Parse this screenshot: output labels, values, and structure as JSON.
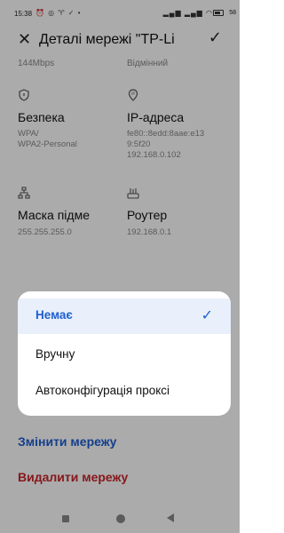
{
  "status_bar": {
    "time": "15:38",
    "left_icons": "⏰ ◎ ♈ ✓ •",
    "right_icons": "▂▄▆ ▂▄▆ ◠",
    "battery": "58"
  },
  "header": {
    "title": "Деталі мережі \"TP-Li",
    "close_icon": "close-icon",
    "confirm_icon": "check-icon"
  },
  "network": {
    "speed": "144Mbps",
    "signal": "Відмінний",
    "security": {
      "label": "Безпека",
      "value_line1": "WPA/",
      "value_line2": "WPA2-Personal"
    },
    "ip": {
      "label": "IP-адреса",
      "value_line1": "fe80::8edd:8aae:e13",
      "value_line2": "9:5f20",
      "value_line3": "192.168.0.102"
    },
    "subnet": {
      "label": "Маска підме",
      "value": "255.255.255.0"
    },
    "router": {
      "label": "Роутер",
      "value": "192.168.0.1"
    }
  },
  "actions": {
    "modify": "Змінити мережу",
    "delete": "Видалити мережу"
  },
  "proxy_dialog": {
    "options": [
      {
        "label": "Немає",
        "selected": true
      },
      {
        "label": "Вручну",
        "selected": false
      },
      {
        "label": "Автоконфігурація проксі",
        "selected": false
      }
    ]
  },
  "colors": {
    "accent": "#1f5fd1",
    "danger": "#c9252b"
  }
}
